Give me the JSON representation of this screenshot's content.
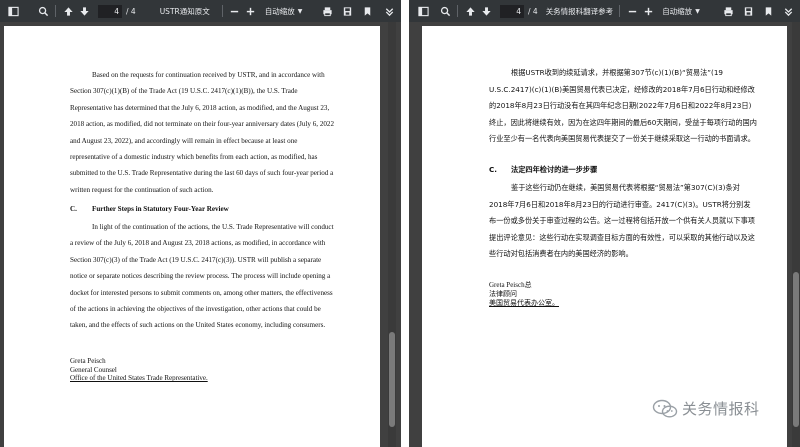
{
  "left": {
    "toolbar": {
      "page_current": "4",
      "page_total": "/ 4",
      "title": "USTR通知原文",
      "zoom": "自动缩放"
    },
    "body": {
      "para1": "Based on the requests for continuation received by USTR, and in accordance with Section 307(c)(1)(B) of the Trade Act (19 U.S.C. 2417(c)(1)(B)), the U.S. Trade Representative has determined that the July 6, 2018 action, as modified, and the August 23, 2018 action, as modified, did not terminate on their four-year anniversary dates (July 6, 2022 and August 23, 2022), and accordingly will remain in effect because at least one representative of a domestic industry which benefits from each action, as modified, has submitted to the U.S. Trade Representative during the last 60 days of such four-year period a written request for the continuation of such action.",
      "heading_letter": "C.",
      "heading_text": "Further Steps in Statutory Four-Year Review",
      "para2": "In light of the continuation of the actions, the U.S. Trade Representative will conduct a review of the July 6, 2018 and August 23, 2018 actions, as modified, in accordance with Section 307(c)(3) of the Trade Act (19 U.S.C. 2417(c)(3)). USTR will publish a separate notice or separate notices describing the review process. The process will include opening a docket for interested persons to submit comments on, among other matters, the effectiveness of the actions in achieving the objectives of the investigation, other actions that could be taken, and the effects of such actions on the United States economy, including consumers.",
      "sig_name": "Greta Peisch",
      "sig_title": "General Counsel",
      "sig_office": "Office of the United States Trade Representative."
    }
  },
  "right": {
    "toolbar": {
      "page_current": "4",
      "page_total": "/ 4",
      "title": "关务情报科翻译参考",
      "zoom": "自动缩放"
    },
    "body": {
      "para1": "根据USTR收到的续延请求，并根据第307节(c)(1)(B)“贸易法”(19 U.S.C.2417)(c)(1)(B)美国贸易代表已决定，经修改的2018年7月6日行动和经修改的2018年8月23日行动没有在其四年纪念日期(2022年7月6日和2022年8月23日)终止，因此将继续有效，因为在这四年期间的最后60天期间，受益于每项行动的国内行业至少有一名代表向美国贸易代表提交了一份关于继续采取这一行动的书面请求。",
      "heading_letter": "C.",
      "heading_text": "法定四年检讨的进一步步骤",
      "para2": "鉴于这些行动仍在继续，美国贸易代表将根据“贸易法”第307(C)(3)条对2018年7月6日和2018年8月23日的行动进行审查。2417(C)(3)。USTR将分别发布一份或多份关于审查过程的公告。这一过程将包括开放一个供有关人员就以下事项提出评论意见：这些行动在实现调查目标方面的有效性，可以采取的其他行动以及这些行动对包括消费者在内的美国经济的影响。",
      "sig_name": "Greta Peisch总",
      "sig_title": "法律顾问",
      "sig_office": "美国贸易代表办公室。"
    }
  },
  "watermark": {
    "text": "关务情报科"
  }
}
